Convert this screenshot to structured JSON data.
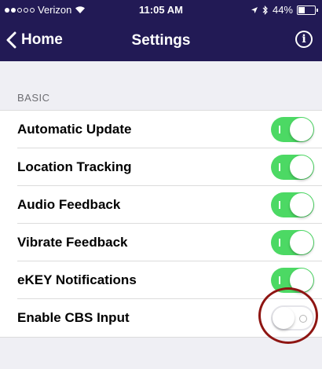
{
  "status_bar": {
    "carrier": "Verizon",
    "time": "11:05 AM",
    "battery": "44%",
    "battery_level": 0.44,
    "signal_bars": 2,
    "icons": [
      "wifi-icon",
      "location-arrow-icon",
      "bluetooth-icon",
      "battery-icon"
    ]
  },
  "nav": {
    "back_label": "Home",
    "title": "Settings",
    "back_icon": "chevron-left-icon",
    "info_icon": "info-icon"
  },
  "section": {
    "header": "BASIC",
    "rows": [
      {
        "name": "automatic-update",
        "label": "Automatic Update",
        "enabled": true
      },
      {
        "name": "location-tracking",
        "label": "Location Tracking",
        "enabled": true
      },
      {
        "name": "audio-feedback",
        "label": "Audio Feedback",
        "enabled": true
      },
      {
        "name": "vibrate-feedback",
        "label": "Vibrate Feedback",
        "enabled": true
      },
      {
        "name": "ekey-notifications",
        "label": "eKEY Notifications",
        "enabled": true
      },
      {
        "name": "enable-cbs-input",
        "label": "Enable CBS Input",
        "enabled": false
      }
    ]
  },
  "colors": {
    "nav_bg": "#221a55",
    "toggle_on": "#4cd964",
    "highlight_circle": "#8e1512",
    "page_bg": "#efeff4"
  }
}
